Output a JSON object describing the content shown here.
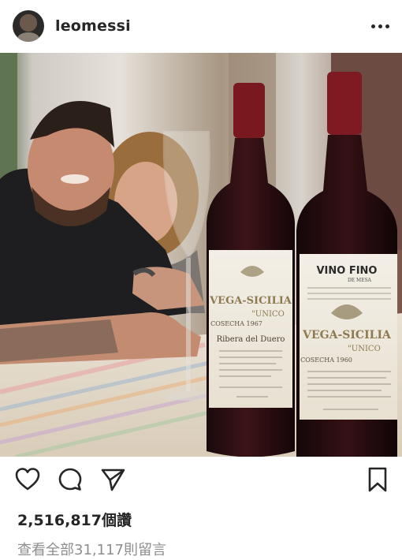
{
  "post": {
    "username": "leomessi",
    "photo": {
      "bottle_left": {
        "brand": "VEGA-SICILIA",
        "line": "\"UNICO",
        "vintage": "COSECHA 1967",
        "region": "Ribera del Duero"
      },
      "bottle_right": {
        "top": "VINO FINO",
        "top_sub": "DE MESA",
        "brand": "VEGA-SICILIA",
        "line": "\"UNICO",
        "vintage": "COSECHA 1960"
      }
    },
    "likes_text": "2,516,817個讚",
    "comments_text": "查看全部31,117則留言"
  },
  "icons": {
    "more": "more-options-icon",
    "like": "heart-icon",
    "comment": "comment-icon",
    "share": "paper-plane-icon",
    "save": "bookmark-icon"
  },
  "colors": {
    "text": "#262626",
    "muted": "#8e8e8e",
    "background": "#ffffff"
  }
}
